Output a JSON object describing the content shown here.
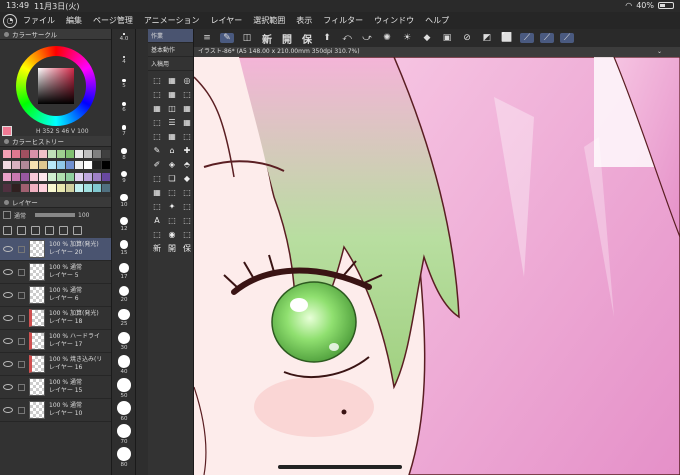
{
  "status": {
    "time": "13:49",
    "date": "11月3日(火)",
    "battery": "40%"
  },
  "menu": [
    "ファイル",
    "編集",
    "ページ管理",
    "アニメーション",
    "レイヤー",
    "選択範囲",
    "表示",
    "フィルター",
    "ウィンドウ",
    "ヘルプ"
  ],
  "color_panel": {
    "title": "カラーサークル",
    "current_color": "#f07a94",
    "values": {
      "h": "352",
      "s": "46",
      "v": "100"
    }
  },
  "history": {
    "title": "カラーヒストリー",
    "colors": [
      "#f4a0b5",
      "#e07890",
      "#a05060",
      "#d890a8",
      "#f0c0c8",
      "#c0e0b8",
      "#a0d090",
      "#80c070",
      "#e8e8e8",
      "#c0c0c0",
      "#808080",
      "#404040",
      "#f0d8e0",
      "#d8b0c0",
      "#b08898",
      "#f8e0b0",
      "#e0c890",
      "#b8e8f8",
      "#90c8e8",
      "#7090d0",
      "#f0f0f0",
      "#ffffff",
      "#202020",
      "#000000",
      "#e8a0c8",
      "#c878b0",
      "#9858a0",
      "#f8c8d8",
      "#ffe8ee",
      "#d0f0d0",
      "#b0e0b0",
      "#90d0a0",
      "#e0d0f0",
      "#c0a8e0",
      "#a080c8",
      "#6848a0",
      "#503040",
      "#302020",
      "#a06070",
      "#f0b0c0",
      "#ffd0dc",
      "#f8f8d0",
      "#e8e8b0",
      "#d0d0a0",
      "#c0f0f0",
      "#a0e0e0",
      "#80c8d0",
      "#507080"
    ]
  },
  "layers": {
    "title": "レイヤー",
    "blend": "通常",
    "opacity": "100",
    "items": [
      {
        "opacity": "100 %",
        "mode": "加算(発光)",
        "name": "レイヤー 20",
        "selected": true
      },
      {
        "opacity": "100 %",
        "mode": "通常",
        "name": "レイヤー 5",
        "selected": false
      },
      {
        "opacity": "100 %",
        "mode": "通常",
        "name": "レイヤー 6",
        "selected": false
      },
      {
        "opacity": "100 %",
        "mode": "加算(発光)",
        "name": "レイヤー 18",
        "selected": false
      },
      {
        "opacity": "100 %",
        "mode": "ハードライ",
        "name": "レイヤー 17",
        "selected": false
      },
      {
        "opacity": "100 %",
        "mode": "焼き込み(リ",
        "name": "レイヤー 16",
        "selected": false
      },
      {
        "opacity": "100 %",
        "mode": "通常",
        "name": "レイヤー 15",
        "selected": false
      },
      {
        "opacity": "100 %",
        "mode": "通常",
        "name": "レイヤー 10",
        "selected": false
      }
    ]
  },
  "brush_sizes": [
    "4.0",
    "4",
    "5",
    "6",
    "7",
    "8",
    "9",
    "10",
    "12",
    "15",
    "17",
    "20",
    "25",
    "30",
    "40",
    "50",
    "60",
    "70",
    "80"
  ],
  "subtool": {
    "tabs": [
      "作業",
      "基本動作",
      "入稿用"
    ],
    "tools": [
      "⬚",
      "▦",
      "◎",
      "⬚",
      "▦",
      "⬚",
      "▦",
      "◫",
      "▦",
      "⬚",
      "☰",
      "▦",
      "⬚",
      "▦",
      "⬚",
      "✎",
      "⌂",
      "✚",
      "✐",
      "◈",
      "⬘",
      "⬚",
      "❏",
      "◆",
      "▦",
      "⬚",
      "⬚",
      "⬚",
      "✦",
      "⬚",
      "A",
      "⬚",
      "⬚",
      "⬚",
      "◉",
      "⬚"
    ],
    "kana": [
      "新",
      "開",
      "保"
    ]
  },
  "cmdbar": [
    "≡",
    "✎",
    "◫",
    "新",
    "開",
    "保",
    "⬆",
    "⤺",
    "⤻",
    "✺",
    "☀",
    "◆",
    "▣",
    "⊘",
    "◩",
    "⬜",
    "⟋",
    "⟋",
    "⟋"
  ],
  "canvas_tab": {
    "label": "イラスト-86* (A5 148.00 x 210.00mm 350dpi 310.7%)",
    "chevron": "⌄"
  },
  "canvas": {
    "hair_color": "#f0a8d0",
    "bang_green": "#a8d890",
    "skin": "#fbe6e4",
    "eye": "#7ad060",
    "line": "#5a1e22"
  }
}
